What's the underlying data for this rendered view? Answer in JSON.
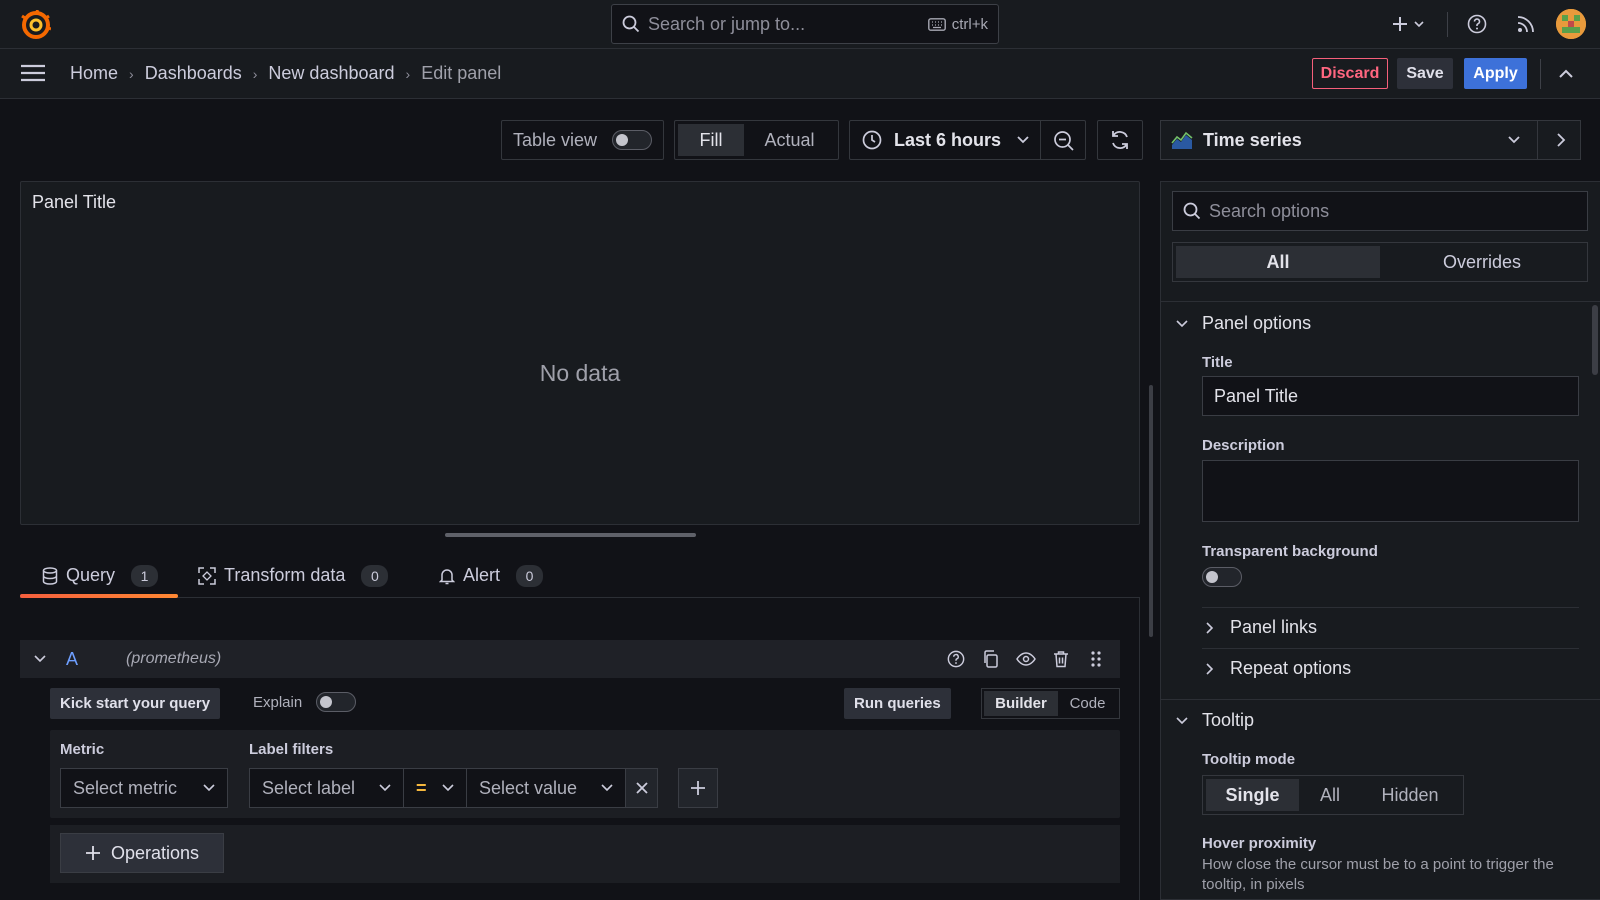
{
  "topbar": {
    "search_placeholder": "Search or jump to...",
    "search_shortcut": "ctrl+k"
  },
  "breadcrumb": {
    "home": "Home",
    "dashboards": "Dashboards",
    "new_dashboard": "New dashboard",
    "current": "Edit panel"
  },
  "actions": {
    "discard": "Discard",
    "save": "Save",
    "apply": "Apply"
  },
  "toolbar": {
    "table_view": "Table view",
    "fill": "Fill",
    "actual": "Actual",
    "time_range": "Last 6 hours"
  },
  "panel": {
    "title": "Panel Title",
    "no_data": "No data"
  },
  "tabs": [
    {
      "label": "Query",
      "count": "1"
    },
    {
      "label": "Transform data",
      "count": "0"
    },
    {
      "label": "Alert",
      "count": "0"
    }
  ],
  "query": {
    "ref_id": "A",
    "datasource": "(prometheus)",
    "kick_start": "Kick start your query",
    "explain": "Explain",
    "run_queries": "Run queries",
    "builder": "Builder",
    "code": "Code",
    "metric_label": "Metric",
    "metric_placeholder": "Select metric",
    "label_filters_label": "Label filters",
    "select_label": "Select label",
    "operator": "=",
    "select_value": "Select value",
    "operations": "Operations"
  },
  "viz": {
    "type": "Time series"
  },
  "options": {
    "search_placeholder": "Search options",
    "tab_all": "All",
    "tab_overrides": "Overrides",
    "panel_options": "Panel options",
    "title_label": "Title",
    "title_value": "Panel Title",
    "description_label": "Description",
    "transparent_label": "Transparent background",
    "panel_links": "Panel links",
    "repeat_options": "Repeat options",
    "tooltip": "Tooltip",
    "tooltip_mode_label": "Tooltip mode",
    "tooltip_modes": [
      "Single",
      "All",
      "Hidden"
    ],
    "hover_proximity_label": "Hover proximity",
    "hover_proximity_desc": "How close the cursor must be to a point to trigger the tooltip, in pixels"
  }
}
